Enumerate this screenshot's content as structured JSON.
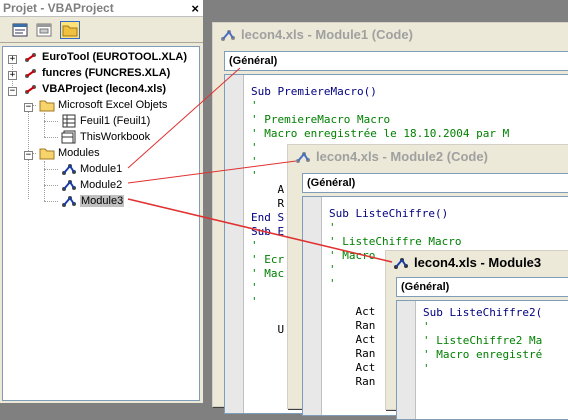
{
  "project": {
    "title": "Projet - VBAProject",
    "close": "×",
    "nodes": {
      "eurotool": "EuroTool (EUROTOOL.XLA)",
      "funcres": "funcres (FUNCRES.XLA)",
      "vbaproject": "VBAProject (lecon4.xls)",
      "excel_objects": "Microsoft Excel Objets",
      "feuil1": "Feuil1 (Feuil1)",
      "thisworkbook": "ThisWorkbook",
      "modules": "Modules",
      "module1": "Module1",
      "module2": "Module2",
      "module3": "Module3"
    }
  },
  "windows": {
    "w1": {
      "title": "lecon4.xls - Module1 (Code)",
      "combo": "(Général)",
      "lines": [
        "Sub PremiereMacro()",
        "'",
        "' PremiereMacro Macro",
        "' Macro enregistrée le 18.10.2004 par M",
        "'",
        "'",
        "'",
        "    A",
        "    R",
        "End S",
        "Sub E",
        "'",
        "' Ecr",
        "' Mac",
        "'",
        "'",
        "",
        "    U"
      ]
    },
    "w2": {
      "title": "lecon4.xls - Module2 (Code)",
      "combo": "(Général)",
      "lines": [
        "Sub ListeChiffre()",
        "'",
        "' ListeChiffre Macro",
        "' Macro",
        "'",
        "'",
        "",
        "    Act",
        "    Ran",
        "    Act",
        "    Ran",
        "    Act",
        "    Ran"
      ]
    },
    "w3": {
      "title": "lecon4.xls - Module3 (Code",
      "combo": "(Général)",
      "lines": [
        "Sub ListeChiffre2(",
        "'",
        "' ListeChiffre2 Ma",
        "' Macro enregistré",
        "'"
      ]
    }
  },
  "colors": {
    "keyword": "#000080",
    "comment": "#008000",
    "arrow": "#e03030"
  }
}
